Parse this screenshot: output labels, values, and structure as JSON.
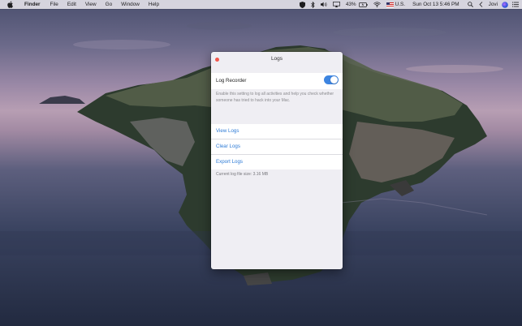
{
  "menubar": {
    "app_name": "Finder",
    "menus": [
      "File",
      "Edit",
      "View",
      "Go",
      "Window",
      "Help"
    ],
    "battery": "43%",
    "input_source": "U.S.",
    "datetime": "Sun Oct 13  5:46 PM",
    "user": "Jovi"
  },
  "window": {
    "title": "Logs",
    "toggle_label": "Log Recorder",
    "toggle_on": true,
    "description": "Enable this setting to log all activities and help you check whether someone has tried to hack into your Mac.",
    "actions": [
      "View Logs",
      "Clear Logs",
      "Export Logs"
    ],
    "file_size": "Current log file size: 3.16 MB"
  },
  "colors": {
    "accent": "#3d84e0",
    "link": "#2e7bd6",
    "close": "#f2574c"
  }
}
